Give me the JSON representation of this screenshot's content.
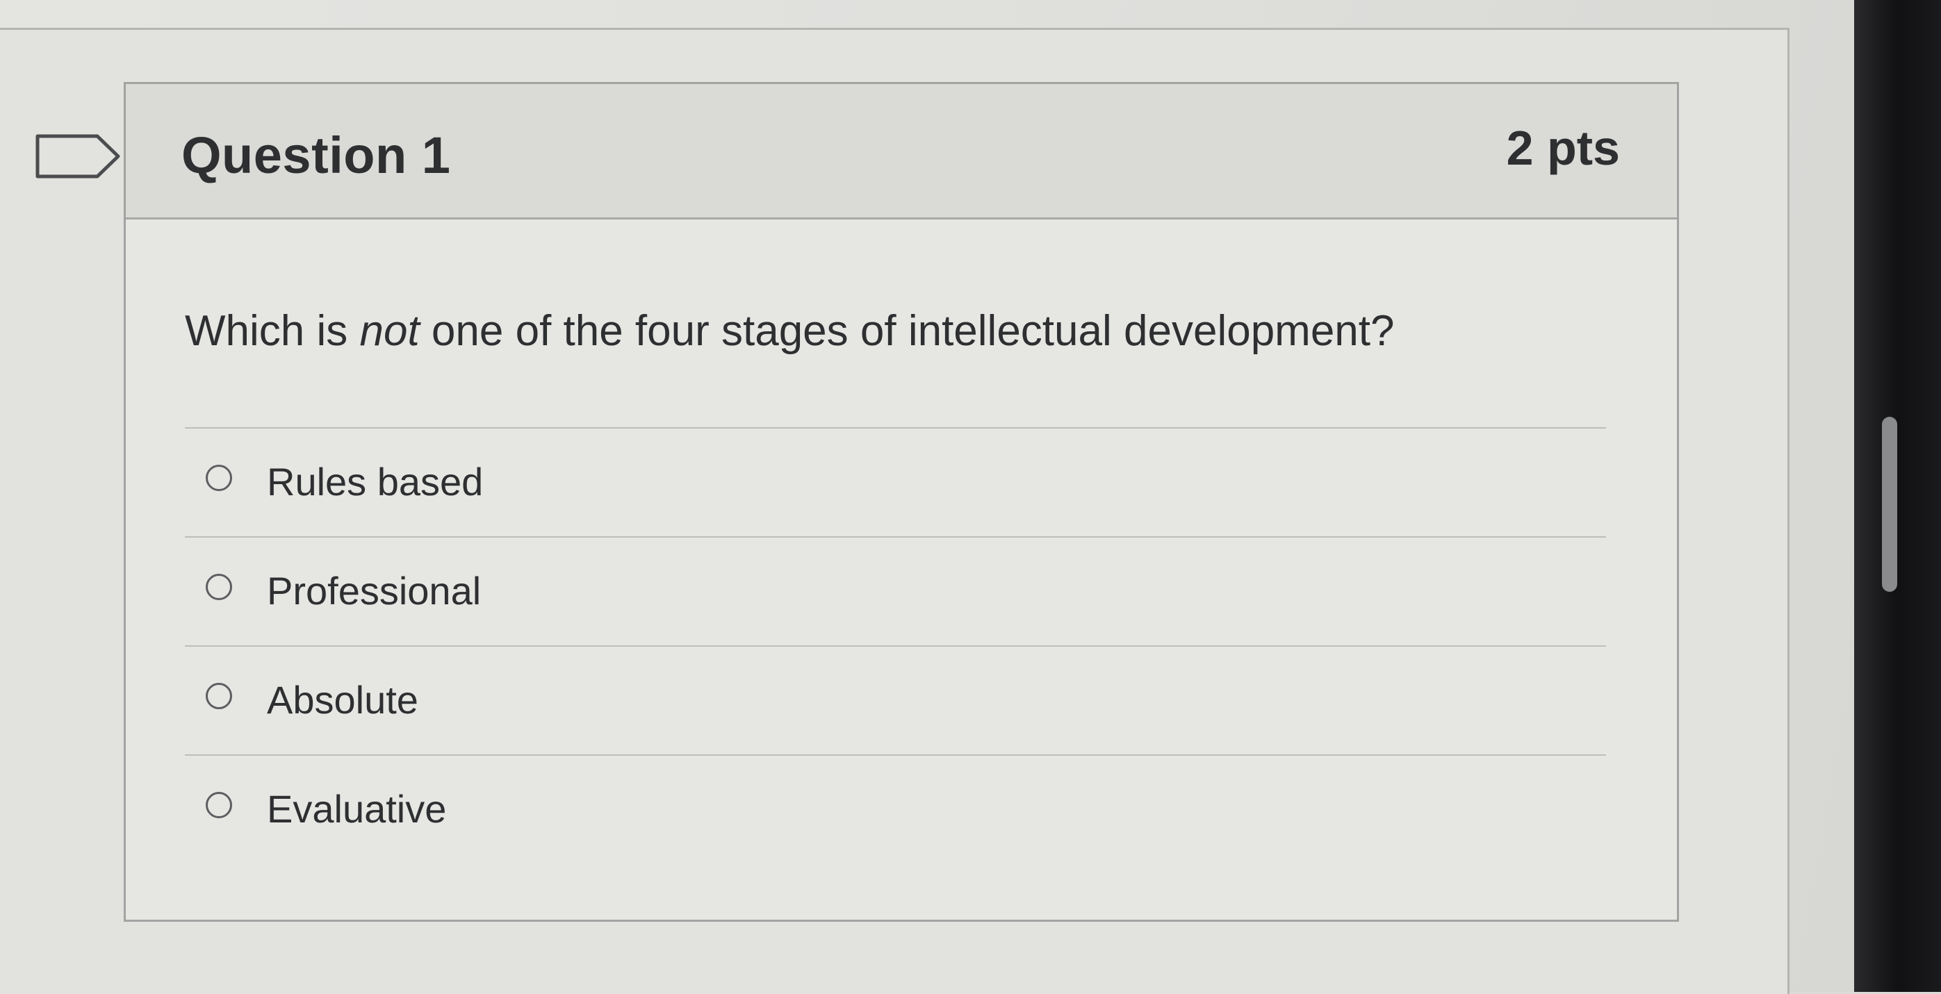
{
  "question": {
    "title": "Question 1",
    "points": "2 pts",
    "text_before": "Which is ",
    "text_emphasis": "not",
    "text_after": " one of the four stages of intellectual development?"
  },
  "answers": [
    {
      "label": "Rules based",
      "selected": false
    },
    {
      "label": "Professional",
      "selected": false
    },
    {
      "label": "Absolute",
      "selected": false
    },
    {
      "label": "Evaluative",
      "selected": false
    }
  ],
  "icons": {
    "flag": "flag-icon",
    "radio": "radio-unchecked-icon"
  },
  "colors": {
    "background": "#dcdcd9",
    "header_background": "#dadad7",
    "card_border": "#a2a3a2",
    "text": "#2d2f31",
    "radio_border": "#5c5e60"
  }
}
